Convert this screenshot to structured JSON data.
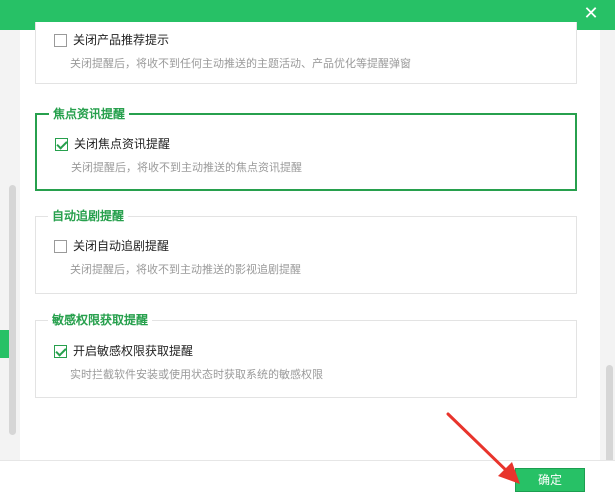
{
  "titlebar": {
    "close_icon": "close-icon",
    "color": "#27c166"
  },
  "sections": [
    {
      "title": "",
      "checkbox_label": "关闭产品推荐提示",
      "checked": false,
      "desc": "关闭提醒后，将收不到任何主动推送的主题活动、产品优化等提醒弹窗"
    },
    {
      "title": "焦点资讯提醒",
      "checkbox_label": "关闭焦点资讯提醒",
      "checked": true,
      "desc": "关闭提醒后，将收不到主动推送的焦点资讯提醒"
    },
    {
      "title": "自动追剧提醒",
      "checkbox_label": "关闭自动追剧提醒",
      "checked": false,
      "desc": "关闭提醒后，将收不到主动推送的影视追剧提醒"
    },
    {
      "title": "敏感权限获取提醒",
      "checkbox_label": "开启敏感权限获取提醒",
      "checked": true,
      "desc": "实时拦截软件安装或使用状态时获取系统的敏感权限"
    }
  ],
  "footer": {
    "ok_label": "确定"
  },
  "colors": {
    "accent": "#27c166",
    "title_green": "#27a04d",
    "annotation_arrow": "#e8342c"
  }
}
